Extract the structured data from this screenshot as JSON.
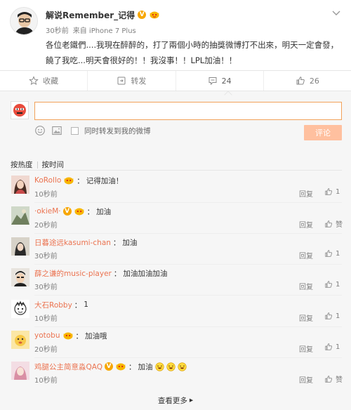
{
  "post": {
    "username": "解说Remember_记得",
    "verified_badge": "V",
    "time": "30秒前",
    "source": "来自 iPhone 7 Plus",
    "text": "各位老鐵們....我現在醉醉的，打了兩個小時的抽獎微博打不出來，明天一定會發，饒了我吃...明天會很好的！！我沒事！！LPL加油！！"
  },
  "actions": [
    {
      "icon": "star-icon",
      "label": "收藏"
    },
    {
      "icon": "repost-icon",
      "label": "转发"
    },
    {
      "icon": "comment-icon",
      "label": "24"
    },
    {
      "icon": "thumbs-up-icon",
      "label": "26"
    }
  ],
  "composer": {
    "input_value": "",
    "repost_checkbox_label": "同时转发到我的微博",
    "submit_label": "评论"
  },
  "sort": {
    "by_hot": "按热度",
    "by_time": "按时间"
  },
  "comments": [
    {
      "name": "KoRollo",
      "badges": "face",
      "separator": "：",
      "text": "记得加油！",
      "time": "10秒前",
      "reply": "回复",
      "likes": "1"
    },
    {
      "name": "·okieM·",
      "badges": "v+face",
      "separator": "：",
      "text": "加油",
      "time": "20秒前",
      "reply": "回复",
      "likes": "赞"
    },
    {
      "name": "日暮途远kasumi-chan",
      "badges": "",
      "separator": "：",
      "text": "加油",
      "time": "30秒前",
      "reply": "回复",
      "likes": "1"
    },
    {
      "name": "薛之谦的music-player",
      "badges": "",
      "separator": "：",
      "text": "加油加油加油",
      "time": "30秒前",
      "reply": "回复",
      "likes": "1"
    },
    {
      "name": "大石Robby",
      "badges": "",
      "separator": "：",
      "text": "1",
      "time": "10秒前",
      "reply": "回复",
      "likes": "1"
    },
    {
      "name": "yotobu",
      "badges": "face",
      "separator": "：",
      "text": "加油哦",
      "time": "20秒前",
      "reply": "回复",
      "likes": "1"
    },
    {
      "name": "鸡腿公主简意淼QAQ",
      "badges": "v+face",
      "separator": "：",
      "text": "加油",
      "time": "10秒前",
      "reply": "回复",
      "likes": "赞"
    }
  ],
  "view_more": "查看更多",
  "view_more_arrow": "▸",
  "colors": {
    "accent": "#eb7350",
    "submit_disabled": "#ffc09f",
    "input_focus_border": "#f2a25a",
    "muted": "#808080",
    "verified": "#f7a600"
  }
}
